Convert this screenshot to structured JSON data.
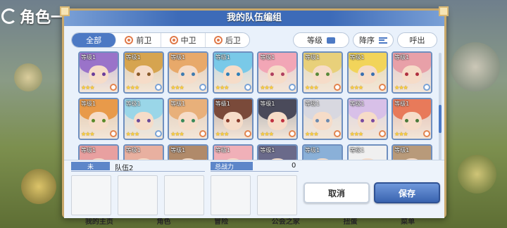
{
  "app": {
    "background_title": "角色一览"
  },
  "dialog": {
    "title": "我的队伍编组"
  },
  "filters": [
    {
      "label": "全部",
      "active": true,
      "icon": "none"
    },
    {
      "label": "前卫",
      "active": false,
      "icon": "front-role-icon"
    },
    {
      "label": "中卫",
      "active": false,
      "icon": "middle-role-icon"
    },
    {
      "label": "后卫",
      "active": false,
      "icon": "back-role-icon"
    }
  ],
  "sort": {
    "field_label": "等级",
    "order_label": "降序",
    "call_label": "呼出"
  },
  "cards": [
    {
      "level": "等级1",
      "stars": "★★★",
      "hair": "#9a73c9",
      "eye": "#6a3d9a",
      "role": "front"
    },
    {
      "level": "等级1",
      "stars": "★★★",
      "hair": "#d6a44f",
      "eye": "#8a5a2a",
      "role": "back"
    },
    {
      "level": "等级1",
      "stars": "★★★",
      "hair": "#e8a96a",
      "eye": "#3f7bb0",
      "role": "back"
    },
    {
      "level": "等级1",
      "stars": "★★★",
      "hair": "#79c9e8",
      "eye": "#2f7fb8",
      "role": "back"
    },
    {
      "level": "等级1",
      "stars": "★★★",
      "hair": "#f2a6b6",
      "eye": "#b04060",
      "role": "back"
    },
    {
      "level": "等级1",
      "stars": "★★★",
      "hair": "#e8d07a",
      "eye": "#5a8a3a",
      "role": "mid"
    },
    {
      "level": "等级1",
      "stars": "★★★",
      "hair": "#f2d45a",
      "eye": "#3a6fb0",
      "role": "mid"
    },
    {
      "level": "等级1",
      "stars": "★★★",
      "hair": "#e8a0a8",
      "eye": "#b03040",
      "role": "back"
    },
    {
      "level": "等级1",
      "stars": "★★★",
      "hair": "#e89a4a",
      "eye": "#5a8a2a",
      "role": "front"
    },
    {
      "level": "等级1",
      "stars": "★★★",
      "hair": "#9ad6e8",
      "eye": "#6a4a9a",
      "role": "back"
    },
    {
      "level": "等级1",
      "stars": "★★★",
      "hair": "#e8b07a",
      "eye": "#3a8a5a",
      "role": "mid"
    },
    {
      "level": "等级1",
      "stars": "★★★",
      "hair": "#7a4a3a",
      "eye": "#8a3a2a",
      "role": "front"
    },
    {
      "level": "等级1",
      "stars": "★★★",
      "hair": "#4a4a5a",
      "eye": "#c03040",
      "role": "front"
    },
    {
      "level": "等级1",
      "stars": "★★★",
      "hair": "#d8d8e0",
      "eye": "#6a8ab0",
      "role": "mid"
    },
    {
      "level": "等级1",
      "stars": "★★★",
      "hair": "#d8c0e8",
      "eye": "#7a4aa0",
      "role": "mid"
    },
    {
      "level": "等级1",
      "stars": "★★★",
      "hair": "#e87a5a",
      "eye": "#4a7a3a",
      "role": "mid"
    },
    {
      "level": "等级1",
      "stars": "",
      "hair": "#e8a0a0",
      "eye": "#a04040",
      "role": "none"
    },
    {
      "level": "等级1",
      "stars": "",
      "hair": "#e8b0a0",
      "eye": "#a05040",
      "role": "none"
    },
    {
      "level": "等级1",
      "stars": "",
      "hair": "#b08a6a",
      "eye": "#6a4a2a",
      "role": "none"
    },
    {
      "level": "等级1",
      "stars": "",
      "hair": "#f0b0b8",
      "eye": "#a04050",
      "role": "none"
    },
    {
      "level": "等级1",
      "stars": "",
      "hair": "#6a6a8a",
      "eye": "#3a3a5a",
      "role": "none"
    },
    {
      "level": "等级1",
      "stars": "",
      "hair": "#8ab0d8",
      "eye": "#3a5a8a",
      "role": "none"
    },
    {
      "level": "等级1",
      "stars": "",
      "hair": "#f0f0f0",
      "eye": "#8a6a5a",
      "role": "none"
    },
    {
      "level": "等级1",
      "stars": "",
      "hair": "#b89a7a",
      "eye": "#6a5a3a",
      "role": "none"
    }
  ],
  "team": {
    "tag": "未",
    "name": "队伍2",
    "power_label": "总战力",
    "power_value": "0"
  },
  "actions": {
    "cancel_label": "取消",
    "save_label": "保存"
  },
  "bottom_nav": [
    "我的主页",
    "角色",
    "冒险",
    "公会之家",
    "扭蛋",
    "菜单"
  ],
  "colors": {
    "accent": "#4c79c4",
    "frame": "#c8a86b",
    "header": "#3d6bb8"
  }
}
